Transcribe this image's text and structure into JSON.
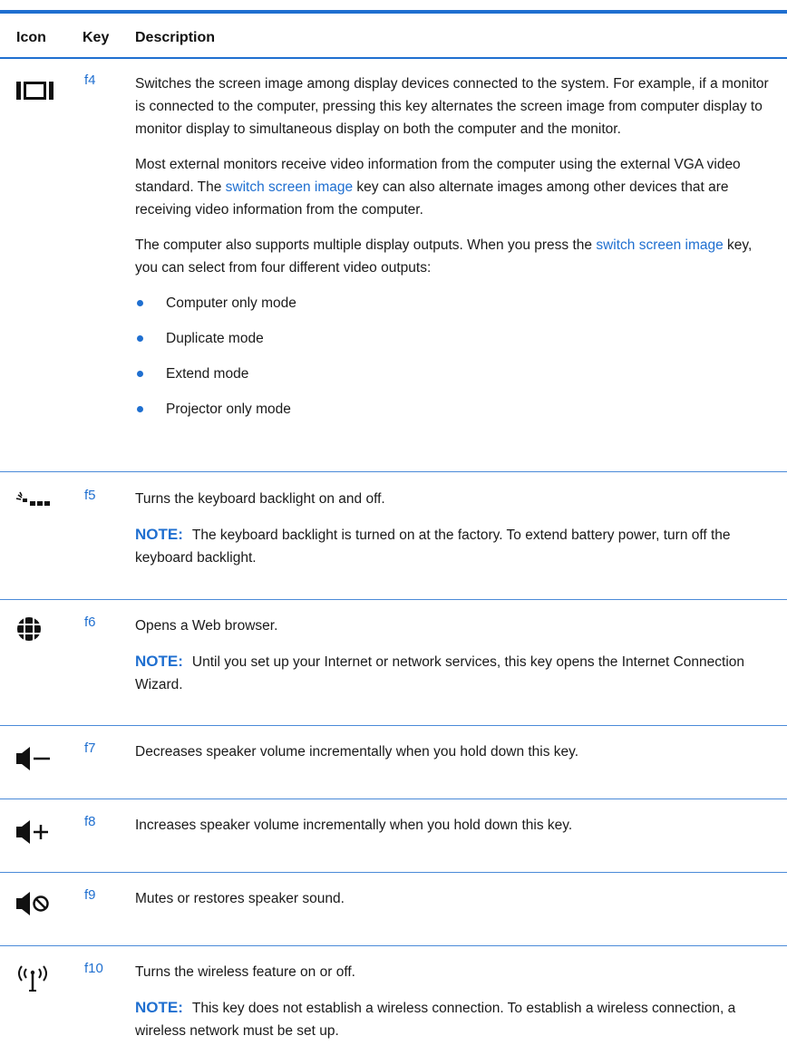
{
  "header": {
    "icon": "Icon",
    "key": "Key",
    "description": "Description"
  },
  "rows": [
    {
      "icon": "switch-screen-icon",
      "key": "f4",
      "p1": "Switches the screen image among display devices connected to the system. For example, if a monitor is connected to the computer, pressing this key alternates the screen image from computer display to monitor display to simultaneous display on both the computer and the monitor.",
      "p2a": "Most external monitors receive video information from the computer using the external VGA video standard. The ",
      "p2link": "switch screen image",
      "p2b": " key can also alternate images among other devices that are receiving video information from the computer.",
      "p3a": "The computer also supports multiple display outputs. When you press the ",
      "p3link": "switch screen image",
      "p3b": " key, you can select from four different video outputs:",
      "modes": [
        "Computer only mode",
        "Duplicate mode",
        "Extend mode",
        "Projector only mode"
      ]
    },
    {
      "icon": "keyboard-backlight-icon",
      "key": "f5",
      "text": "Turns the keyboard backlight on and off.",
      "note_label": "NOTE:",
      "note": "The keyboard backlight is turned on at the factory. To extend battery power, turn off the keyboard backlight."
    },
    {
      "icon": "web-browser-globe-icon",
      "key": "f6",
      "text": "Opens a Web browser.",
      "note_label": "NOTE:",
      "note": "Until you set up your Internet or network services, this key opens the Internet Connection Wizard."
    },
    {
      "icon": "volume-down-icon",
      "key": "f7",
      "text": "Decreases speaker volume incrementally when you hold down this key."
    },
    {
      "icon": "volume-up-icon",
      "key": "f8",
      "text": "Increases speaker volume incrementally when you hold down this key."
    },
    {
      "icon": "volume-mute-icon",
      "key": "f9",
      "text": "Mutes or restores speaker sound."
    },
    {
      "icon": "wireless-icon",
      "key": "f10",
      "text": "Turns the wireless feature on or off.",
      "note_label": "NOTE:",
      "note": "This key does not establish a wireless connection. To establish a wireless connection, a wireless network must be set up."
    }
  ]
}
